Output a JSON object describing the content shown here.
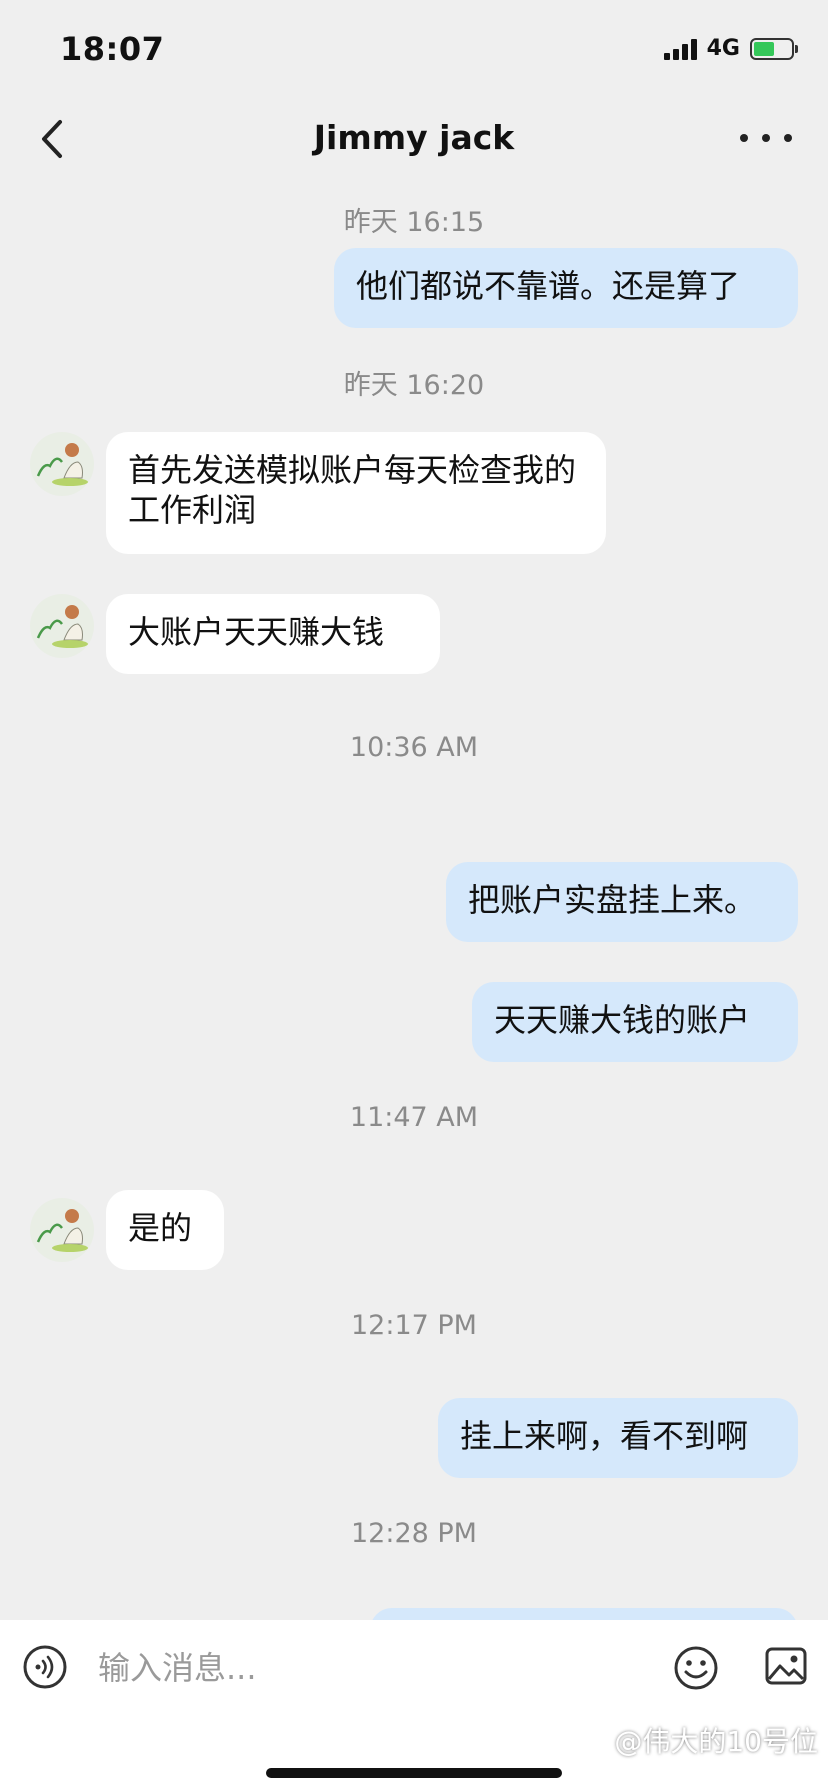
{
  "status_bar": {
    "time": "18:07",
    "network": "4G",
    "battery_percent": 55
  },
  "header": {
    "title": "Jimmy jack"
  },
  "messages": [
    {
      "type": "time",
      "text": "昨天 16:15"
    },
    {
      "type": "out",
      "text": "他们都说不靠谱。还是算了"
    },
    {
      "type": "time",
      "text": "昨天 16:20"
    },
    {
      "type": "in",
      "text": "首先发送模拟账户每天检查我的工作利润"
    },
    {
      "type": "in",
      "text": "大账户天天赚大钱"
    },
    {
      "type": "time",
      "text": "10:36 AM"
    },
    {
      "type": "out",
      "text": "把账户实盘挂上来。"
    },
    {
      "type": "out",
      "text": "天天赚大钱的账户"
    },
    {
      "type": "time",
      "text": "11:47 AM"
    },
    {
      "type": "in",
      "text": "是的"
    },
    {
      "type": "time",
      "text": "12:17 PM"
    },
    {
      "type": "out",
      "text": "挂上来啊，看不到啊"
    },
    {
      "type": "time",
      "text": "12:28 PM"
    }
  ],
  "input": {
    "placeholder": "输入消息..."
  },
  "watermark": "@伟大的10号位",
  "colors": {
    "background": "#efefef",
    "outgoing_bubble": "#d5e8fb",
    "incoming_bubble": "#ffffff",
    "battery": "#34c759"
  }
}
